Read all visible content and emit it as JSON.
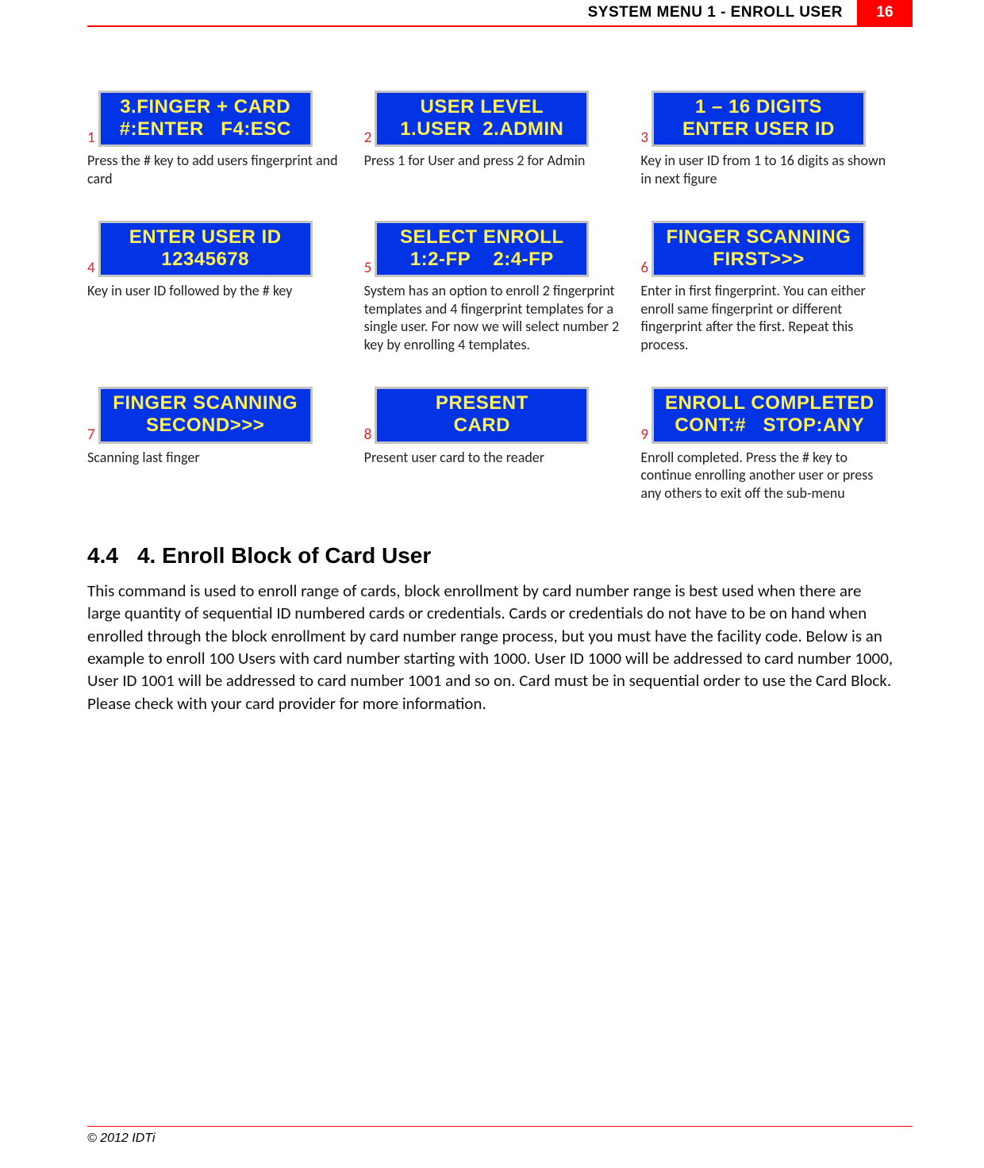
{
  "header": {
    "title": "SYSTEM MENU 1 - ENROLL USER",
    "page_number": "16"
  },
  "steps": [
    {
      "num": "1",
      "lcd": [
        "3.FINGER + CARD",
        "#:ENTER   F4:ESC"
      ],
      "caption": "Press the # key to add users fingerprint and card"
    },
    {
      "num": "2",
      "lcd": [
        "USER LEVEL",
        "1.USER  2.ADMIN"
      ],
      "caption": "Press 1 for User and press 2 for Admin"
    },
    {
      "num": "3",
      "lcd": [
        "1 – 16 DIGITS",
        "ENTER USER ID"
      ],
      "caption": "Key in user ID from 1 to 16 digits as shown in next figure"
    },
    {
      "num": "4",
      "lcd": [
        "ENTER USER ID",
        "12345678"
      ],
      "caption": "Key in user ID followed by the # key"
    },
    {
      "num": "5",
      "lcd": [
        "SELECT ENROLL",
        "1:2-FP    2:4-FP"
      ],
      "caption": "System has an option to enroll 2 fingerprint templates and 4 fingerprint templates for a single user. For now we will select number 2 key by enrolling 4 templates."
    },
    {
      "num": "6",
      "lcd": [
        "FINGER SCANNING",
        "FIRST>>>"
      ],
      "caption": "Enter in first fingerprint. You can either enroll same fingerprint or different fingerprint after the first. Repeat this process."
    },
    {
      "num": "7",
      "lcd": [
        "FINGER SCANNING",
        "SECOND>>>"
      ],
      "caption": "Scanning last finger"
    },
    {
      "num": "8",
      "lcd": [
        "PRESENT",
        "CARD"
      ],
      "caption": "Present user card to the reader"
    },
    {
      "num": "9",
      "lcd": [
        "ENROLL COMPLETED",
        "CONT:#   STOP:ANY"
      ],
      "caption": "Enroll completed. Press the # key to continue enrolling another user or press any others to exit off the sub-menu"
    }
  ],
  "section": {
    "number": "4.4",
    "title": "4. Enroll Block of Card User",
    "body": "This command is used to enroll range of cards, block enrollment by card number range is best used when there are large quantity of sequential ID numbered cards or credentials. Cards or credentials do not have to be on hand when enrolled through the block enrollment by card number range process, but you must have the facility code. Below is an example to enroll 100 Users with card number starting with 1000. User ID 1000 will be addressed to card number 1000, User ID 1001 will be addressed to card number 1001 and so on. Card must be in sequential order to use the Card Block. Please check with your card provider for more information."
  },
  "footer": {
    "copyright": "© 2012 IDTi"
  }
}
